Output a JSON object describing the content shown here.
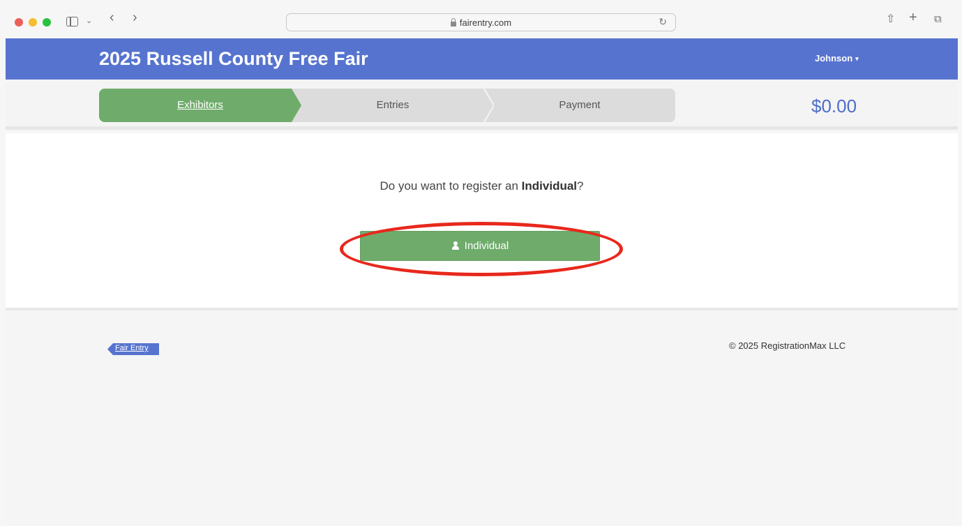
{
  "browser": {
    "url": "fairentry.com"
  },
  "header": {
    "title": "2025 Russell County Free Fair",
    "user": "Johnson"
  },
  "steps": [
    {
      "label": "Exhibitors",
      "active": true
    },
    {
      "label": "Entries",
      "active": false
    },
    {
      "label": "Payment",
      "active": false
    }
  ],
  "total": "$0.00",
  "main": {
    "prompt_prefix": "Do you want to register an ",
    "prompt_bold": "Individual",
    "prompt_suffix": "?",
    "button_label": "Individual"
  },
  "footer": {
    "logo_text": "Fair Entry",
    "copyright": "© 2025 RegistrationMax LLC"
  },
  "colors": {
    "header_bg": "#5674cf",
    "step_active": "#6fac6b",
    "button_bg": "#6fac6b",
    "annotation": "#e8281c"
  }
}
